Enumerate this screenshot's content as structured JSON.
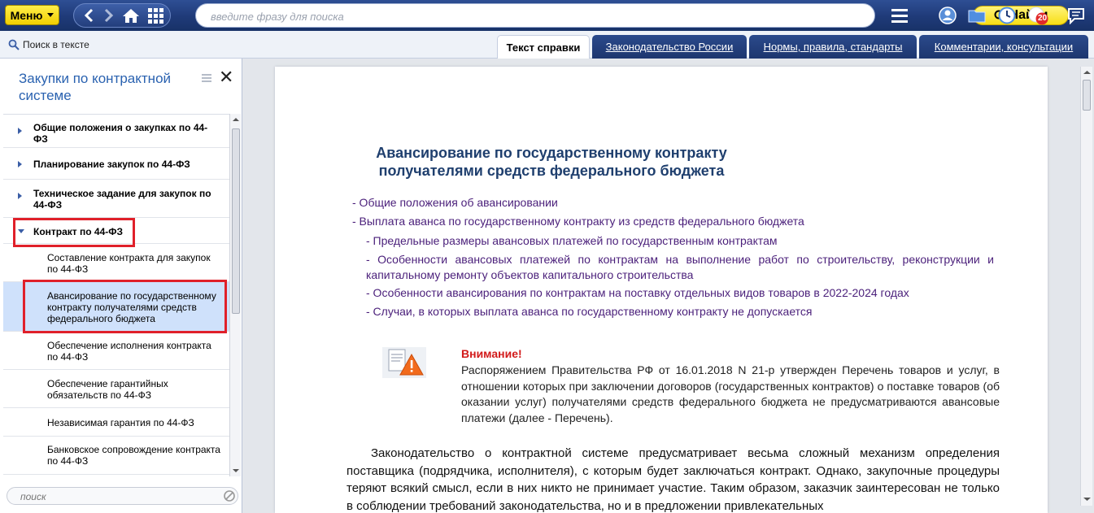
{
  "topbar": {
    "menu_label": "Меню",
    "search_placeholder": "введите фразу для поиска",
    "find_label": "Найти",
    "notification_count": "20"
  },
  "secondbar": {
    "search_in_text": "Поиск в тексте",
    "tabs": [
      {
        "label": "Текст справки",
        "active": true
      },
      {
        "label": "Законодательство России",
        "active": false
      },
      {
        "label": "Нормы, правила, стандарты",
        "active": false
      },
      {
        "label": "Комментарии, консультации",
        "active": false
      }
    ]
  },
  "leftpanel": {
    "title": "Закупки по контрактной системе",
    "items": [
      {
        "label": "Общие положения о закупках по 44-ФЗ"
      },
      {
        "label": "Планирование закупок по 44-ФЗ"
      },
      {
        "label": "Техническое задание для закупок по 44-ФЗ"
      },
      {
        "label": "Контракт по 44-ФЗ"
      },
      {
        "label": "Составление контракта для закупок по 44-ФЗ"
      },
      {
        "label": "Авансирование по государственному контракту получателями средств федерального бюджета"
      },
      {
        "label": "Обеспечение исполнения контракта по 44-ФЗ"
      },
      {
        "label": "Обеспечение гарантийных обязательств по 44-ФЗ"
      },
      {
        "label": "Независимая гарантия по 44-ФЗ"
      },
      {
        "label": "Банковское сопровождение контракта по 44-ФЗ"
      }
    ],
    "bottom_search_placeholder": "поиск"
  },
  "document": {
    "title": "Авансирование по государственному контракту получателями средств федерального бюджета",
    "toc": [
      "- Общие положения об авансировании",
      "- Выплата аванса по государственному контракту из средств федерального бюджета",
      "- Предельные размеры авансовых платежей по государственным контрактам",
      "- Особенности авансовых платежей по контрактам на выполнение работ по строительству, реконструкции и капитальному ремонту объектов капитального строительства",
      "- Особенности авансирования по контрактам на поставку отдельных видов товаров в 2022-2024 годах",
      "- Случаи, в которых выплата аванса по государственному контракту не допускается"
    ],
    "warning_title": "Внимание!",
    "warning_text": "Распоряжением Правительства РФ от 16.01.2018 N 21-р утвержден Перечень товаров и услуг, в отношении которых при заключении договоров (государственных контрактов) о поставке товаров (об оказании услуг) получателями средств федерального бюджета не предусматриваются авансовые платежи (далее - Перечень).",
    "body_paragraph": "Законодательство о контрактной системе предусматривает весьма сложный механизм определения поставщика (подрядчика, исполнителя), с которым будет заключаться контракт. Однако, закупочные процедуры теряют всякий смысл, если в них никто не принимает участие. Таким образом, заказчик заинтересован не только в соблюдении требований законодательства, но и в предложении привлекательных"
  },
  "colors": {
    "topbar": "#1f3a78",
    "accent_yellow": "#f7de16",
    "highlight": "#e0202a",
    "title_blue": "#2a62b0",
    "toc_purple": "#4a1f7a",
    "warning_red": "#d21a1a"
  }
}
